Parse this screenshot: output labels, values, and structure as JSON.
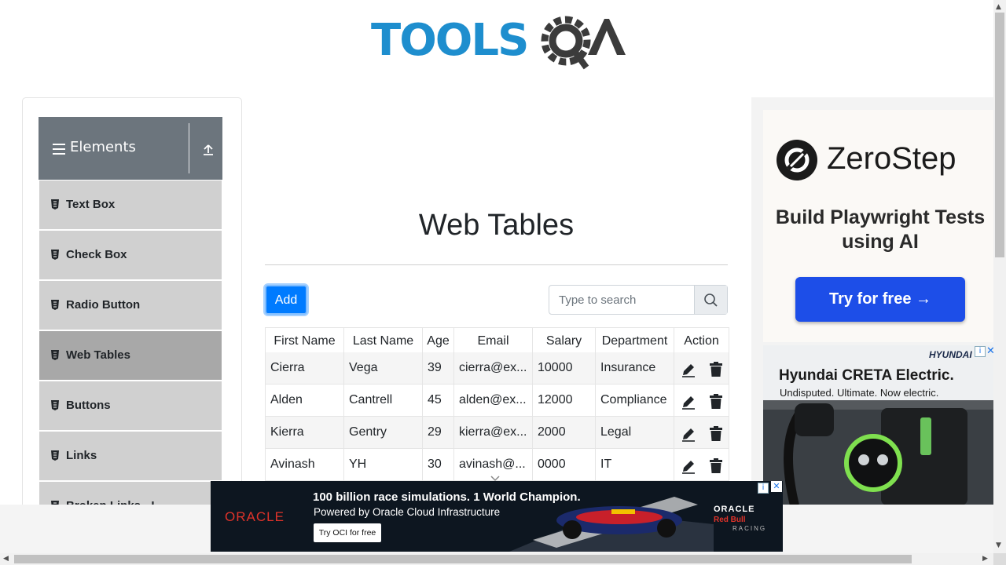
{
  "header": {
    "logo_text": "TOOLSQA"
  },
  "sidebar": {
    "group_title": "Elements",
    "items": [
      {
        "label": "Text Box",
        "active": false
      },
      {
        "label": "Check Box",
        "active": false
      },
      {
        "label": "Radio Button",
        "active": false
      },
      {
        "label": "Web Tables",
        "active": true
      },
      {
        "label": "Buttons",
        "active": false
      },
      {
        "label": "Links",
        "active": false
      },
      {
        "label": "Broken Links - I",
        "active": false
      }
    ]
  },
  "main": {
    "title": "Web Tables",
    "add_label": "Add",
    "search": {
      "placeholder": "Type to search",
      "value": ""
    },
    "table": {
      "headers": [
        "First Name",
        "Last Name",
        "Age",
        "Email",
        "Salary",
        "Department",
        "Action"
      ],
      "rows": [
        [
          "Cierra",
          "Vega",
          "39",
          "cierra@ex...",
          "10000",
          "Insurance"
        ],
        [
          "Alden",
          "Cantrell",
          "45",
          "alden@ex...",
          "12000",
          "Compliance"
        ],
        [
          "Kierra",
          "Gentry",
          "29",
          "kierra@ex...",
          "2000",
          "Legal"
        ],
        [
          "Avinash",
          "YH",
          "30",
          "avinash@...",
          "0000",
          "IT"
        ]
      ]
    }
  },
  "ads": {
    "right_top": {
      "brand": "ZeroStep",
      "headline": "Build Playwright Tests using AI",
      "cta": "Try for free →"
    },
    "right_bottom": {
      "brand": "HYUNDAI",
      "title": "Hyundai CRETA Electric.",
      "subtitle": "Undisputed. Ultimate. Now electric."
    },
    "bottom_banner": {
      "brand": "ORACLE",
      "line1": "100 billion race simulations. 1 World Champion.",
      "line2": "Powered by Oracle Cloud Infrastructure",
      "cta": "Try OCI for free",
      "partner1": "ORACLE",
      "partner2": "Red Bull",
      "partner3": "RACING"
    }
  },
  "colors": {
    "accent": "#007bff",
    "sidebar_header": "#6c757d",
    "menu_item": "#d0d0d0",
    "menu_active": "#a8a8a8",
    "logo_blue": "#1e8ece",
    "logo_dark": "#3b3b3b"
  },
  "icons": {
    "menu": "hamburger-icon",
    "collapse": "upload-arrow-icon",
    "item": "html5-icon",
    "search": "search-icon",
    "edit": "pencil-icon",
    "delete": "trash-icon"
  }
}
